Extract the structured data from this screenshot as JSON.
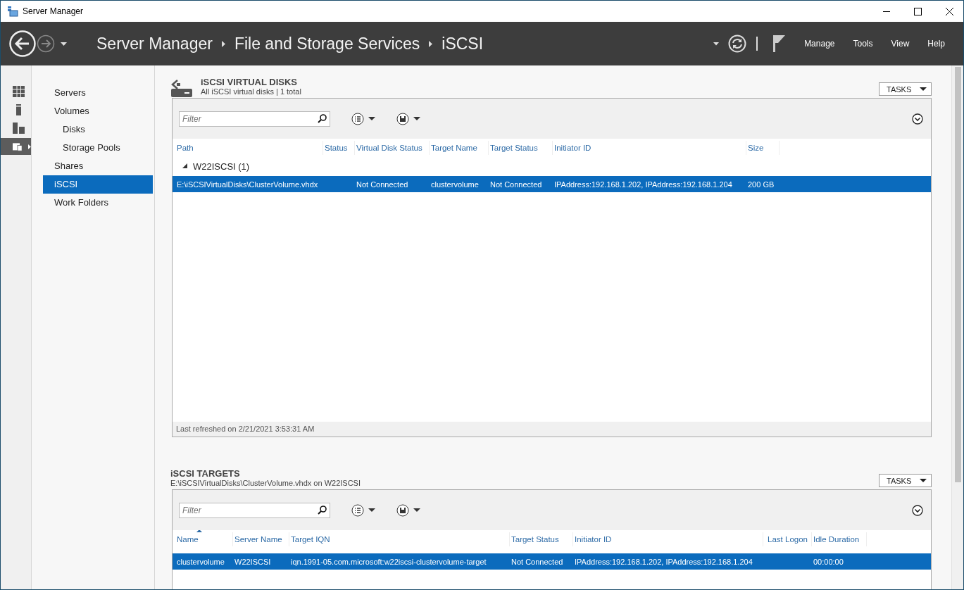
{
  "window": {
    "title": "Server Manager"
  },
  "header": {
    "breadcrumb": [
      "Server Manager",
      "File and Storage Services",
      "iSCSI"
    ],
    "menu": [
      "Manage",
      "Tools",
      "View",
      "Help"
    ]
  },
  "rail": [
    {
      "selected": false
    },
    {
      "selected": false
    },
    {
      "selected": false
    },
    {
      "selected": true
    }
  ],
  "nav": [
    {
      "label": "Servers",
      "selected": false
    },
    {
      "label": "Volumes",
      "selected": false,
      "children": [
        {
          "label": "Disks",
          "selected": false
        },
        {
          "label": "Storage Pools",
          "selected": false
        }
      ]
    },
    {
      "label": "Shares",
      "selected": false
    },
    {
      "label": "iSCSI",
      "selected": true
    },
    {
      "label": "Work Folders",
      "selected": false
    }
  ],
  "sections": [
    {
      "kind": "virtual-disks",
      "title": "iSCSI VIRTUAL DISKS",
      "subtitle": "All iSCSI virtual disks | 1 total",
      "tasks": "TASKS",
      "filter": {
        "placeholder": "Filter"
      },
      "columns": [
        {
          "label": "Path"
        },
        {
          "label": "Status"
        },
        {
          "label": "Virtual Disk Status"
        },
        {
          "label": "Target Name"
        },
        {
          "label": "Target Status"
        },
        {
          "label": "Initiator ID"
        },
        {
          "label": "Size"
        }
      ],
      "groups": [
        {
          "label": "W22ISCSI (1)",
          "expanded": true,
          "rows": [
            {
              "selected": true,
              "cells": [
                "E:\\iSCSIVirtualDisks\\ClusterVolume.vhdx",
                "",
                "Not Connected",
                "clustervolume",
                "Not Connected",
                "IPAddress:192.168.1.202, IPAddress:192.168.1.204",
                "200 GB"
              ]
            }
          ]
        }
      ],
      "footer": "Last refreshed on 2/21/2021 3:53:31 AM"
    },
    {
      "kind": "targets",
      "title": "iSCSI TARGETS",
      "subtitle": "E:\\iSCSIVirtualDisks\\ClusterVolume.vhdx on W22ISCSI",
      "tasks": "TASKS",
      "filter": {
        "placeholder": "Filter"
      },
      "columns": [
        {
          "label": "Name",
          "sorted": true
        },
        {
          "label": "Server Name"
        },
        {
          "label": "Target IQN"
        },
        {
          "label": "Target Status"
        },
        {
          "label": "Initiator ID"
        },
        {
          "label": "Last Logon"
        },
        {
          "label": "Idle Duration"
        }
      ],
      "rows": [
        {
          "selected": true,
          "cells": [
            "clustervolume",
            "W22ISCSI",
            "iqn.1991-05.com.microsoft:w22iscsi-clustervolume-target",
            "Not Connected",
            "IPAddress:192.168.1.202, IPAddress:192.168.1.204",
            "",
            "00:00:00"
          ]
        }
      ]
    }
  ]
}
